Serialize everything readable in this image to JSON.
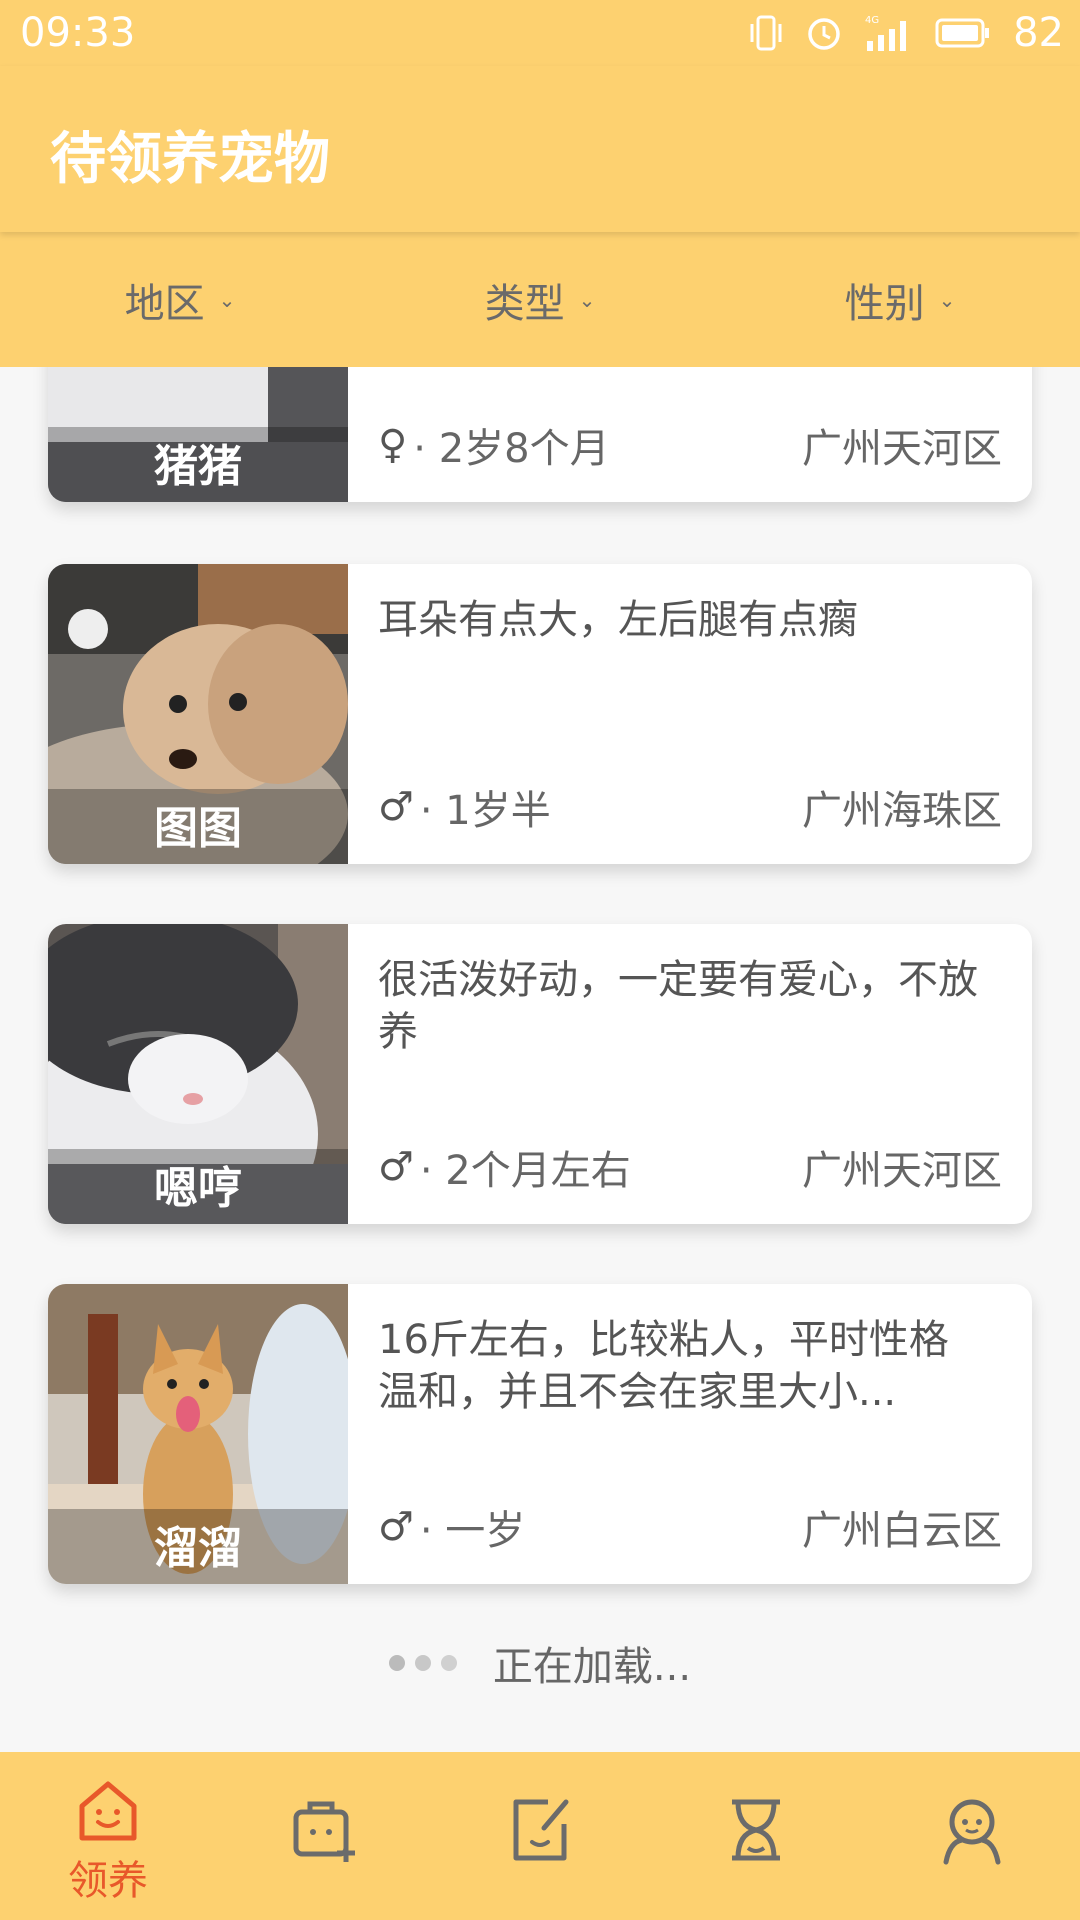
{
  "status_bar": {
    "time": "09:33",
    "battery": "82",
    "network": "4G"
  },
  "app_bar": {
    "title": "待领养宠物"
  },
  "filters": [
    {
      "label": "地区"
    },
    {
      "label": "类型"
    },
    {
      "label": "性别"
    }
  ],
  "pets": [
    {
      "name": "猪猪",
      "description": "",
      "sex": "♀",
      "age": "· 2岁8个月",
      "location": "广州天河区"
    },
    {
      "name": "图图",
      "description": "耳朵有点大，左后腿有点瘸",
      "sex": "♂",
      "age": "· 1岁半",
      "location": "广州海珠区"
    },
    {
      "name": "嗯哼",
      "description": "很活泼好动，一定要有爱心，不放养",
      "sex": "♂",
      "age": "· 2个月左右",
      "location": "广州天河区"
    },
    {
      "name": "溜溜",
      "description": "16斤左右，比较粘人，平时性格温和，并且不会在家里大小...",
      "sex": "♂",
      "age": "· 一岁",
      "location": "广州白云区"
    }
  ],
  "loading_text": "正在加载...",
  "tab_bar": {
    "accent_color": "#e8582a",
    "icon_color": "#6b6b6b",
    "tabs": [
      {
        "label": "领养",
        "icon": "house-smile-icon",
        "active": true
      },
      {
        "label": "",
        "icon": "pet-carrier-add-icon",
        "active": false
      },
      {
        "label": "",
        "icon": "edit-note-icon",
        "active": false
      },
      {
        "label": "",
        "icon": "hourglass-icon",
        "active": false
      },
      {
        "label": "",
        "icon": "person-icon",
        "active": false
      }
    ]
  }
}
